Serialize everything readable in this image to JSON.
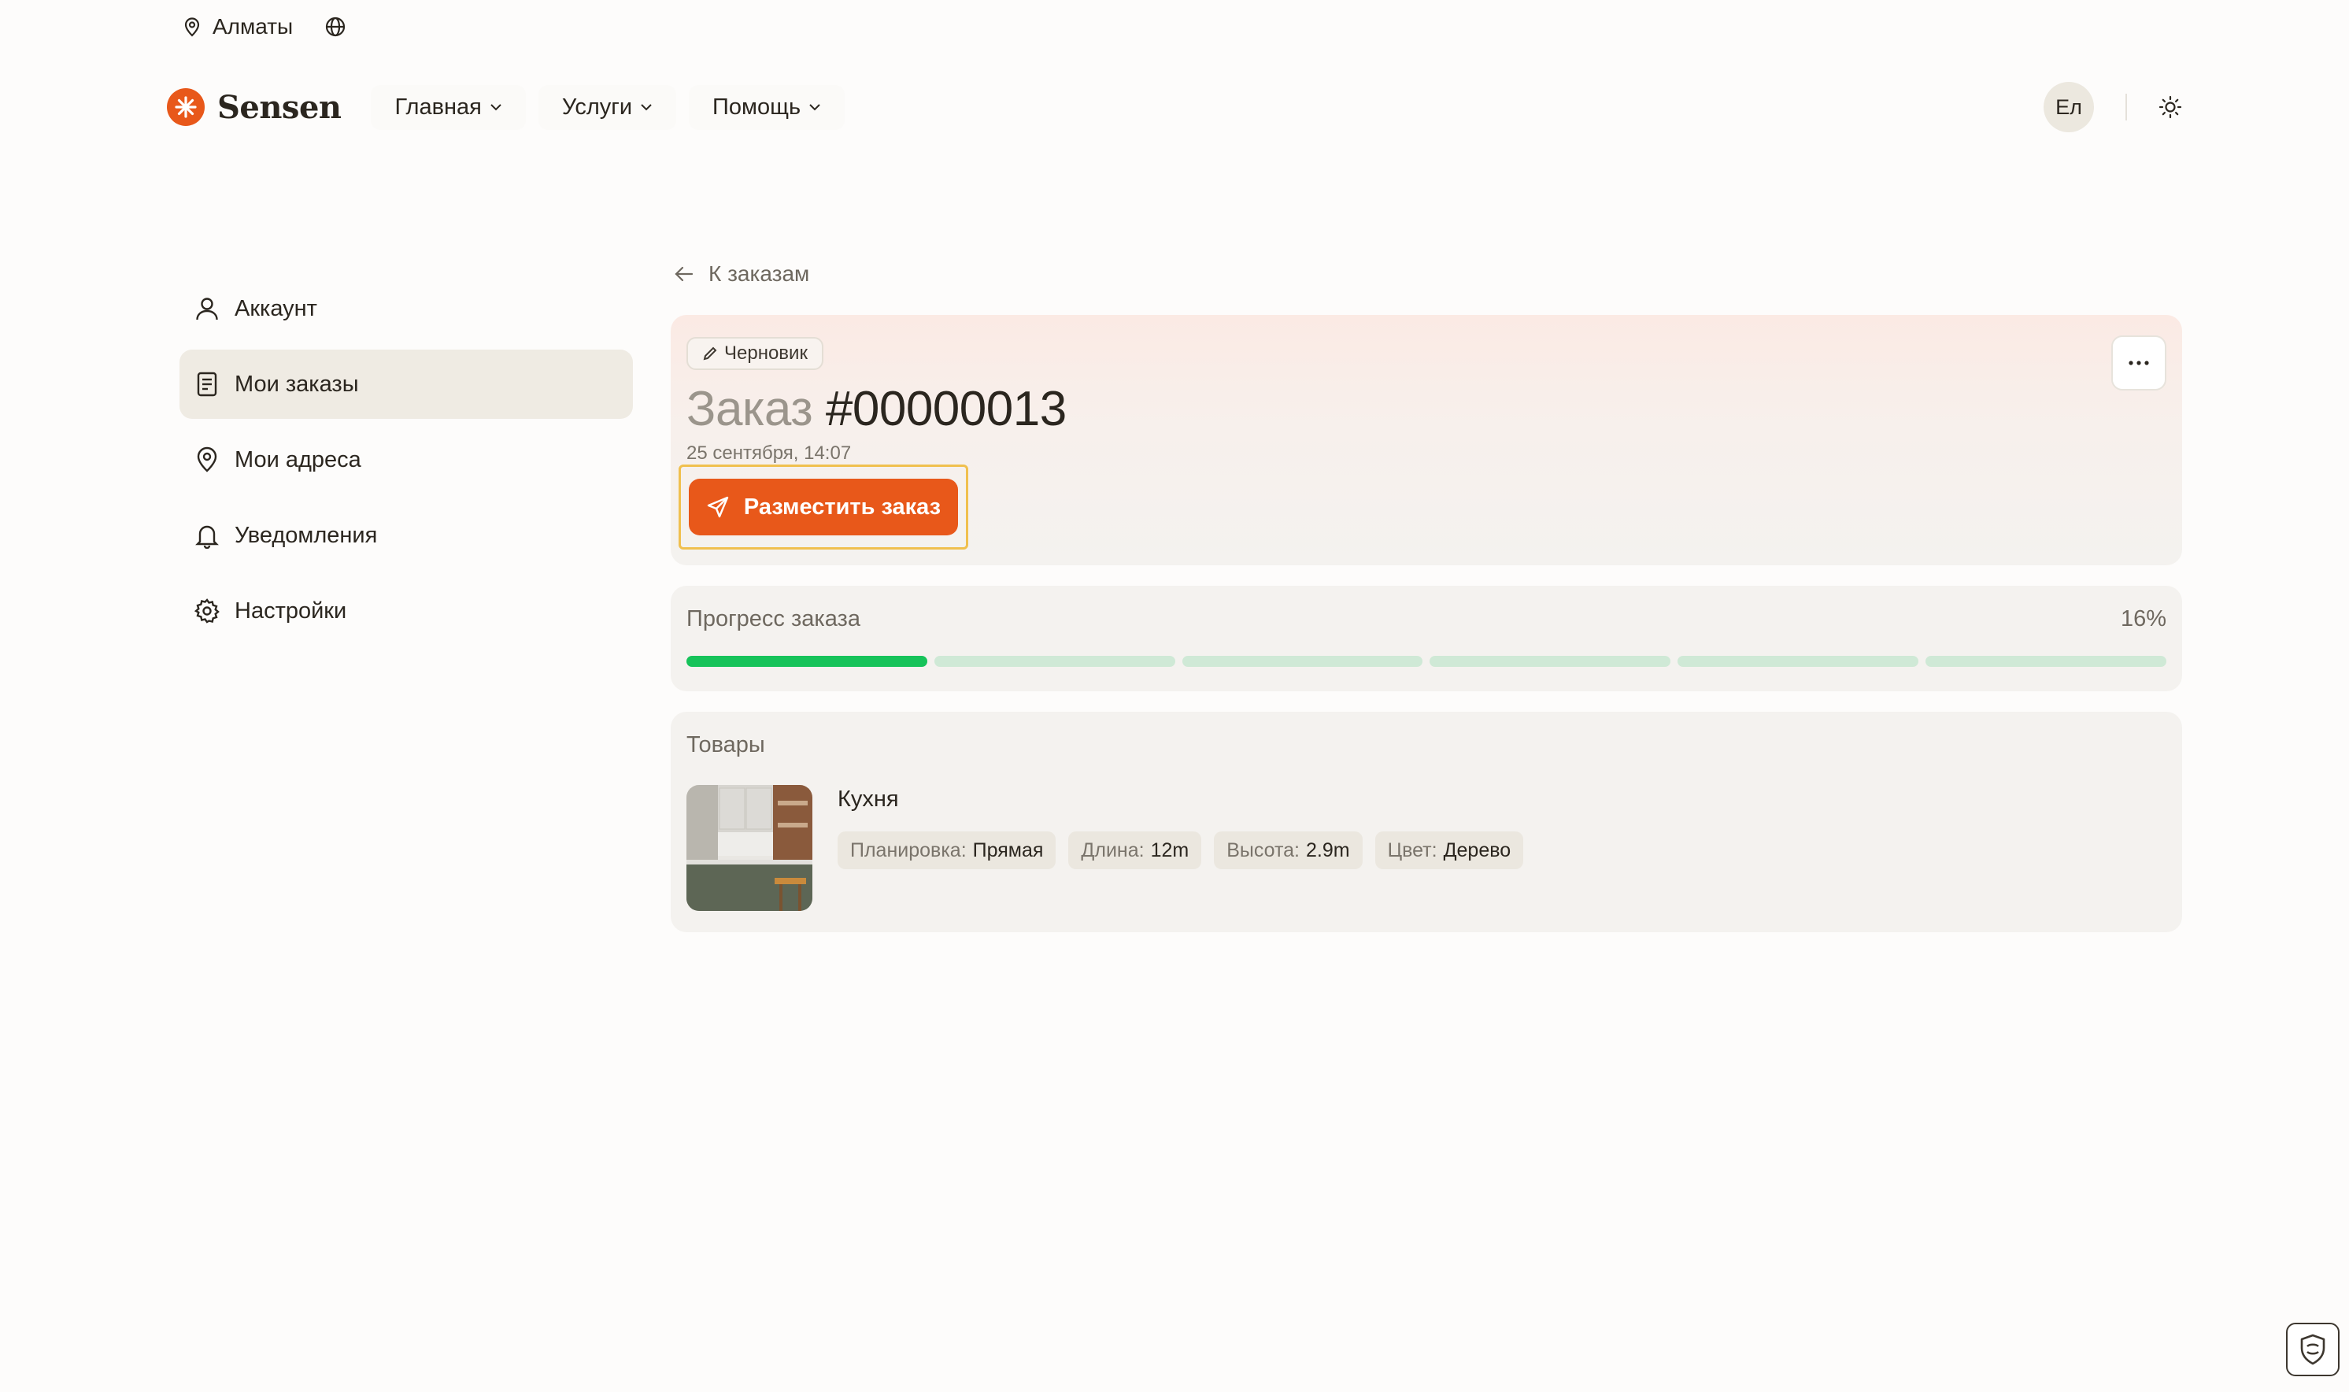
{
  "topbar": {
    "city": "Алматы",
    "icons": [
      "map-pin-icon",
      "globe-icon"
    ]
  },
  "header": {
    "logo_text": "Sensen",
    "nav": [
      {
        "label": "Главная"
      },
      {
        "label": "Услуги"
      },
      {
        "label": "Помощь"
      }
    ],
    "avatar_initials": "Ел",
    "theme_icon": "sun-icon"
  },
  "sidebar": {
    "items": [
      {
        "label": "Аккаунт",
        "icon": "user-icon",
        "active": false
      },
      {
        "label": "Мои заказы",
        "icon": "document-icon",
        "active": true
      },
      {
        "label": "Мои адреса",
        "icon": "map-pin-icon",
        "active": false
      },
      {
        "label": "Уведомления",
        "icon": "bell-icon",
        "active": false
      },
      {
        "label": "Настройки",
        "icon": "gear-icon",
        "active": false
      }
    ]
  },
  "main": {
    "back_label": "К заказам",
    "order": {
      "status_badge": "Черновик",
      "title_prefix": "Заказ",
      "number": "#00000013",
      "date": "25 сентября, 14:07",
      "place_button": "Разместить заказ"
    },
    "progress": {
      "label": "Прогресс заказа",
      "percent_text": "16%",
      "total_steps": 6,
      "completed_steps": 1
    },
    "goods": {
      "title": "Товары",
      "items": [
        {
          "name": "Кухня",
          "attributes": [
            {
              "key": "Планировка:",
              "value": "Прямая"
            },
            {
              "key": "Длина:",
              "value": "12m"
            },
            {
              "key": "Высота:",
              "value": "2.9m"
            },
            {
              "key": "Цвет:",
              "value": "Дерево"
            }
          ]
        }
      ]
    }
  },
  "colors": {
    "accent": "#e8581a",
    "progress_done": "#16c35a",
    "progress_todo": "#cfe9d6",
    "highlight_outline": "#f0c04e"
  }
}
